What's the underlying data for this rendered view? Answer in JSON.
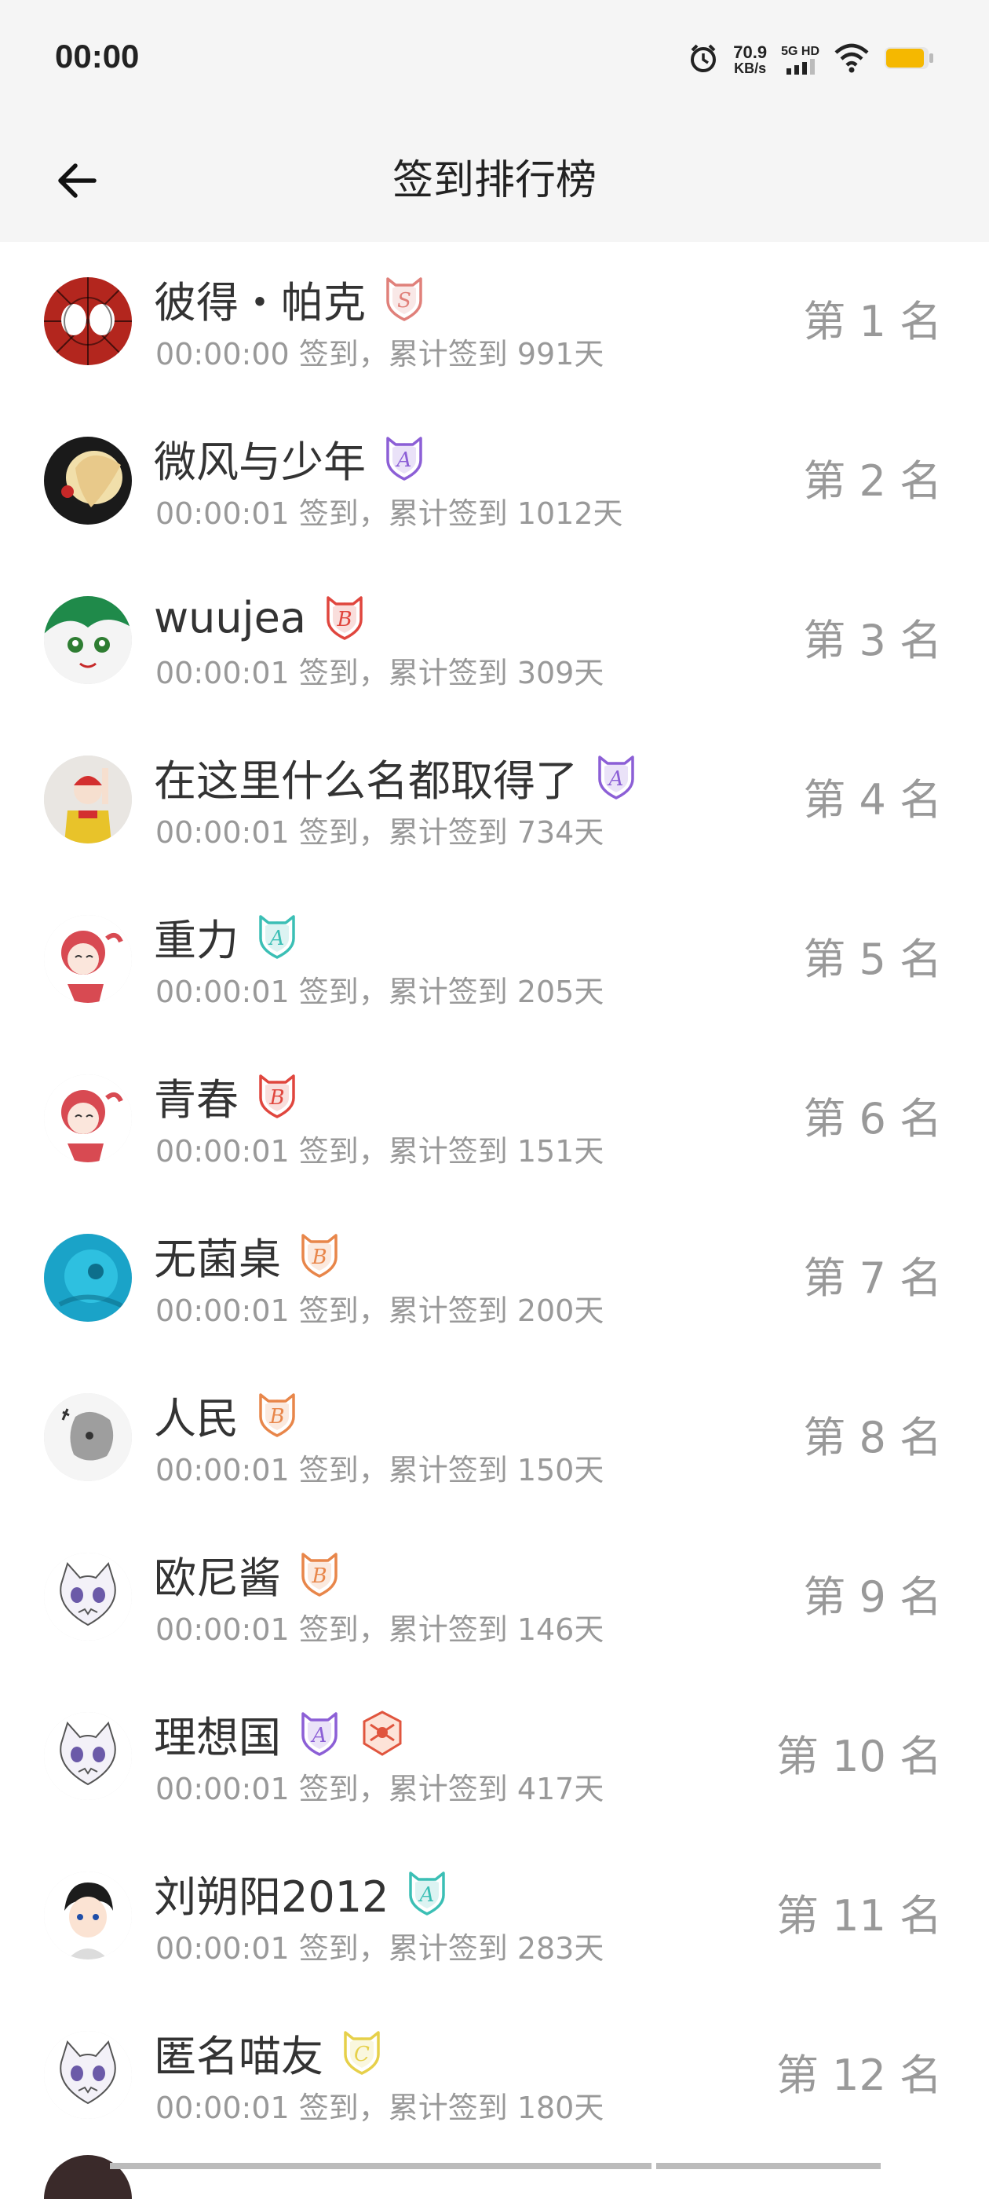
{
  "status_bar": {
    "time": "00:00",
    "net_speed": "70.9",
    "net_unit": "KB/s",
    "signal_label": "5G HD",
    "battery_color": "#f5b800"
  },
  "header": {
    "title": "签到排行榜",
    "back_icon": "arrow-left-icon"
  },
  "ranking": [
    {
      "name": "彼得・帕克",
      "info": "00:00:00 签到，累计签到 991天",
      "rank": "第 1 名",
      "badges": [
        {
          "letter": "S",
          "color": "#e0807a"
        }
      ],
      "avatar": "spiderman"
    },
    {
      "name": "微风与少年",
      "info": "00:00:01 签到，累计签到 1012天",
      "rank": "第 2 名",
      "badges": [
        {
          "letter": "A",
          "color": "#8c5fd6"
        }
      ],
      "avatar": "dark-blonde"
    },
    {
      "name": "wuujea",
      "info": "00:00:01 签到，累计签到 309天",
      "rank": "第 3 名",
      "badges": [
        {
          "letter": "B",
          "color": "#e0463e"
        }
      ],
      "avatar": "green-anime"
    },
    {
      "name": "在这里什么名都取得了",
      "info": "00:00:01 签到，累计签到 734天",
      "rank": "第 4 名",
      "badges": [
        {
          "letter": "A",
          "color": "#8c5fd6"
        }
      ],
      "avatar": "clown"
    },
    {
      "name": "重力",
      "info": "00:00:01 签到，累计签到 205天",
      "rank": "第 5 名",
      "badges": [
        {
          "letter": "A",
          "color": "#3bbfb5"
        }
      ],
      "avatar": "red-anime"
    },
    {
      "name": "青春",
      "info": "00:00:01 签到，累计签到 151天",
      "rank": "第 6 名",
      "badges": [
        {
          "letter": "B",
          "color": "#e0463e"
        }
      ],
      "avatar": "red-anime"
    },
    {
      "name": "无菌桌",
      "info": "00:00:01 签到，累计签到 200天",
      "rank": "第 7 名",
      "badges": [
        {
          "letter": "B",
          "color": "#e8864a"
        }
      ],
      "avatar": "blue-circle"
    },
    {
      "name": "人民",
      "info": "00:00:01 签到，累计签到 150天",
      "rank": "第 8 名",
      "badges": [
        {
          "letter": "B",
          "color": "#e8864a"
        }
      ],
      "avatar": "gray-sketch"
    },
    {
      "name": "欧尼酱",
      "info": "00:00:01 签到，累计签到 146天",
      "rank": "第 9 名",
      "badges": [
        {
          "letter": "B",
          "color": "#e8864a"
        }
      ],
      "avatar": "cat-sketch"
    },
    {
      "name": "理想国",
      "info": "00:00:01 签到，累计签到 417天",
      "rank": "第 10 名",
      "badges": [
        {
          "letter": "A",
          "color": "#8c5fd6"
        },
        {
          "letter": "",
          "color": "#e0553e"
        }
      ],
      "avatar": "cat-sketch"
    },
    {
      "name": "刘朔阳2012",
      "info": "00:00:01 签到，累计签到 283天",
      "rank": "第 11 名",
      "badges": [
        {
          "letter": "A",
          "color": "#3bbfb5"
        }
      ],
      "avatar": "boy-anime"
    },
    {
      "name": "匿名喵友",
      "info": "00:00:01 签到，累计签到 180天",
      "rank": "第 12 名",
      "badges": [
        {
          "letter": "C",
          "color": "#e6d04a"
        }
      ],
      "avatar": "cat-sketch"
    }
  ]
}
